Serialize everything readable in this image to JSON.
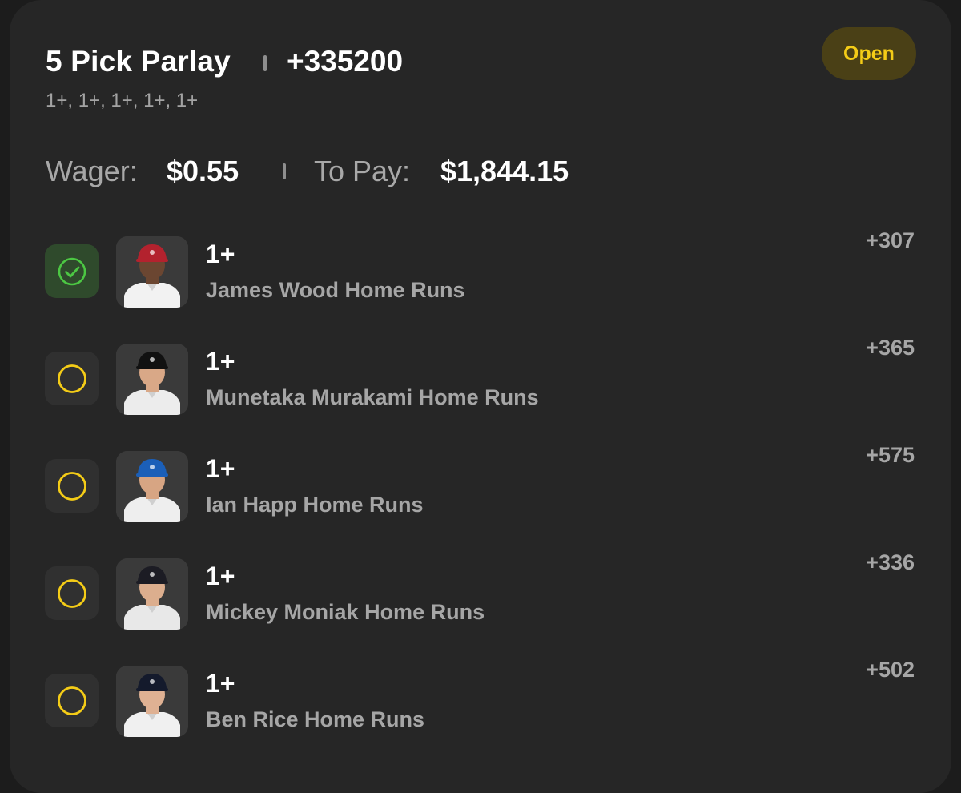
{
  "parlay": {
    "title": "5 Pick Parlay",
    "odds": "+335200",
    "legs_summary": "1+, 1+, 1+, 1+, 1+",
    "status": "Open"
  },
  "bet": {
    "wager_label": "Wager:",
    "wager_value": "$0.55",
    "to_pay_label": "To Pay:",
    "to_pay_value": "$1,844.15"
  },
  "legs": [
    {
      "line": "1+",
      "market": "James Wood Home Runs",
      "odds": "+307",
      "status": "won",
      "cap_color": "#b3222e",
      "jersey": "#f2f2f2",
      "skin": "#6b4631"
    },
    {
      "line": "1+",
      "market": "Munetaka Murakami Home Runs",
      "odds": "+365",
      "status": "pending",
      "cap_color": "#111111",
      "jersey": "#ececec",
      "skin": "#d9a887"
    },
    {
      "line": "1+",
      "market": "Ian Happ Home Runs",
      "odds": "+575",
      "status": "pending",
      "cap_color": "#1b5fb8",
      "jersey": "#eeeeee",
      "skin": "#d7a583"
    },
    {
      "line": "1+",
      "market": "Mickey Moniak Home Runs",
      "odds": "+336",
      "status": "pending",
      "cap_color": "#1c1c24",
      "jersey": "#e8e8e8",
      "skin": "#dcae8e"
    },
    {
      "line": "1+",
      "market": "Ben Rice Home Runs",
      "odds": "+502",
      "status": "pending",
      "cap_color": "#141a2c",
      "jersey": "#f0f0f0",
      "skin": "#dfb193"
    }
  ],
  "colors": {
    "accent_yellow": "#f4cc17",
    "won_green": "#4cc743",
    "badge_bg": "#4a4016"
  },
  "icons": {
    "won": "check-circle-icon",
    "pending": "empty-circle-icon"
  }
}
